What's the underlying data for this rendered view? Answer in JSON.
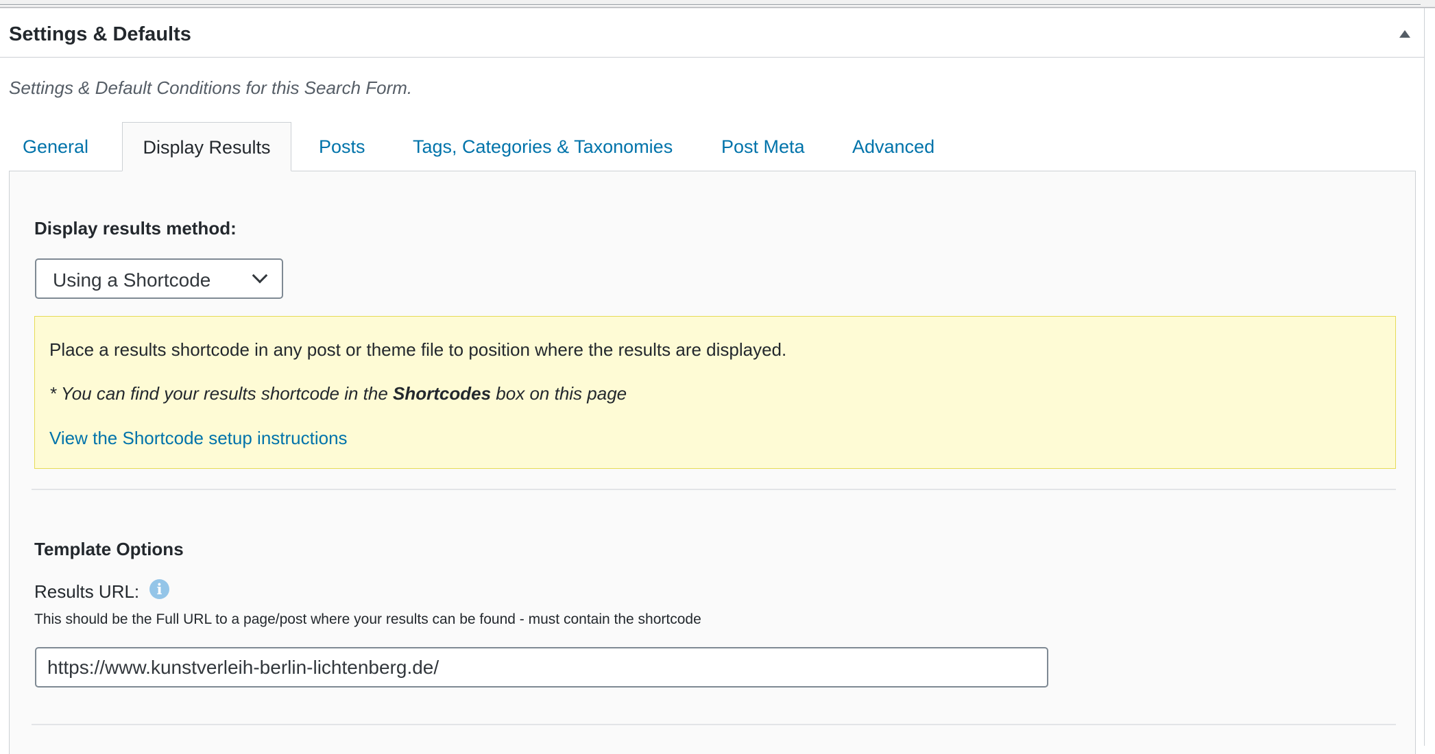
{
  "postbox": {
    "title": "Settings & Defaults",
    "description": "Settings & Default Conditions for this Search Form."
  },
  "tabs": [
    {
      "label": "General",
      "active": false
    },
    {
      "label": "Display Results",
      "active": true
    },
    {
      "label": "Posts",
      "active": false
    },
    {
      "label": "Tags, Categories & Taxonomies",
      "active": false
    },
    {
      "label": "Post Meta",
      "active": false
    },
    {
      "label": "Advanced",
      "active": false
    }
  ],
  "display_results": {
    "method_label": "Display results method:",
    "method_value": "Using a Shortcode",
    "notice": {
      "line1": "Place a results shortcode in any post or theme file to position where the results are displayed.",
      "line2_prefix": "* You can find your results shortcode in the ",
      "line2_bold": "Shortcodes",
      "line2_suffix": " box on this page",
      "link": "View the Shortcode setup instructions"
    },
    "template_options_title": "Template Options",
    "results_url_label": "Results URL:",
    "results_url_help": "This should be the Full URL to a page/post where your results can be found - must contain the shortcode",
    "results_url_value": "https://www.kunstverleih-berlin-lichtenberg.de/"
  },
  "icons": {
    "toggle": "collapse-arrow-icon",
    "select": "chevron-down-icon",
    "info": "info-icon"
  },
  "colors": {
    "link": "#0073aa",
    "notice_bg": "#fefbd5",
    "notice_border": "#e6db55",
    "info_icon": "#94c5e8"
  }
}
